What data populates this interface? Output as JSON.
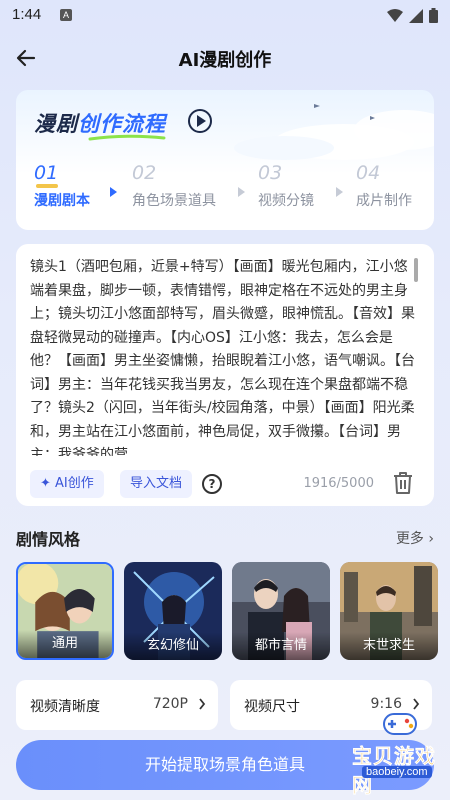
{
  "status": {
    "time": "1:44",
    "notification_letter": "A"
  },
  "header": {
    "title": "AI漫剧创作"
  },
  "flow": {
    "title_plain": "漫剧",
    "title_highlight": "创作流程",
    "steps": [
      {
        "num": "01",
        "label": "漫剧剧本",
        "active": true
      },
      {
        "num": "02",
        "label": "角色场景道具",
        "active": false
      },
      {
        "num": "03",
        "label": "视频分镜",
        "active": false
      },
      {
        "num": "04",
        "label": "成片制作",
        "active": false
      }
    ]
  },
  "script": {
    "text": "镜头1（酒吧包厢，近景+特写）【画面】暖光包厢内，江小悠端着果盘，脚步一顿，表情错愕，眼神定格在不远处的男主身上；镜头切江小悠面部特写，眉头微蹙，眼神慌乱。【音效】果盘轻微晃动的碰撞声。【内心OS】江小悠：我去，怎么会是他？【画面】男主坐姿慵懒，抬眼睨着江小悠，语气嘲讽。【台词】男主：当年花钱买我当男友，怎么现在连个果盘都端不稳了？镜头2（闪回，当年街头/校园角落，中景）【画面】阳光柔和，男主站在江小悠面前，神色局促，双手微攥。【台词】男主：我爷爷的营",
    "ai_button": "AI创作",
    "import_button": "导入文档",
    "help": "?",
    "count": "1916/5000"
  },
  "styles": {
    "title": "剧情风格",
    "more": "更多",
    "items": [
      {
        "label": "通用",
        "selected": true
      },
      {
        "label": "玄幻修仙",
        "selected": false
      },
      {
        "label": "都市言情",
        "selected": false
      },
      {
        "label": "末世求生",
        "selected": false
      }
    ]
  },
  "options": {
    "resolution_label": "视频清晰度",
    "resolution_value": "720P",
    "size_label": "视频尺寸",
    "size_value": "9:16"
  },
  "start_button": "开始提取场景角色道具",
  "watermark": {
    "text": "宝贝游戏网",
    "url": "baobeiy.com"
  },
  "colors": {
    "accent": "#2f6bff",
    "highlight_bar": "#f3c54a",
    "button": "#7b9bff"
  }
}
